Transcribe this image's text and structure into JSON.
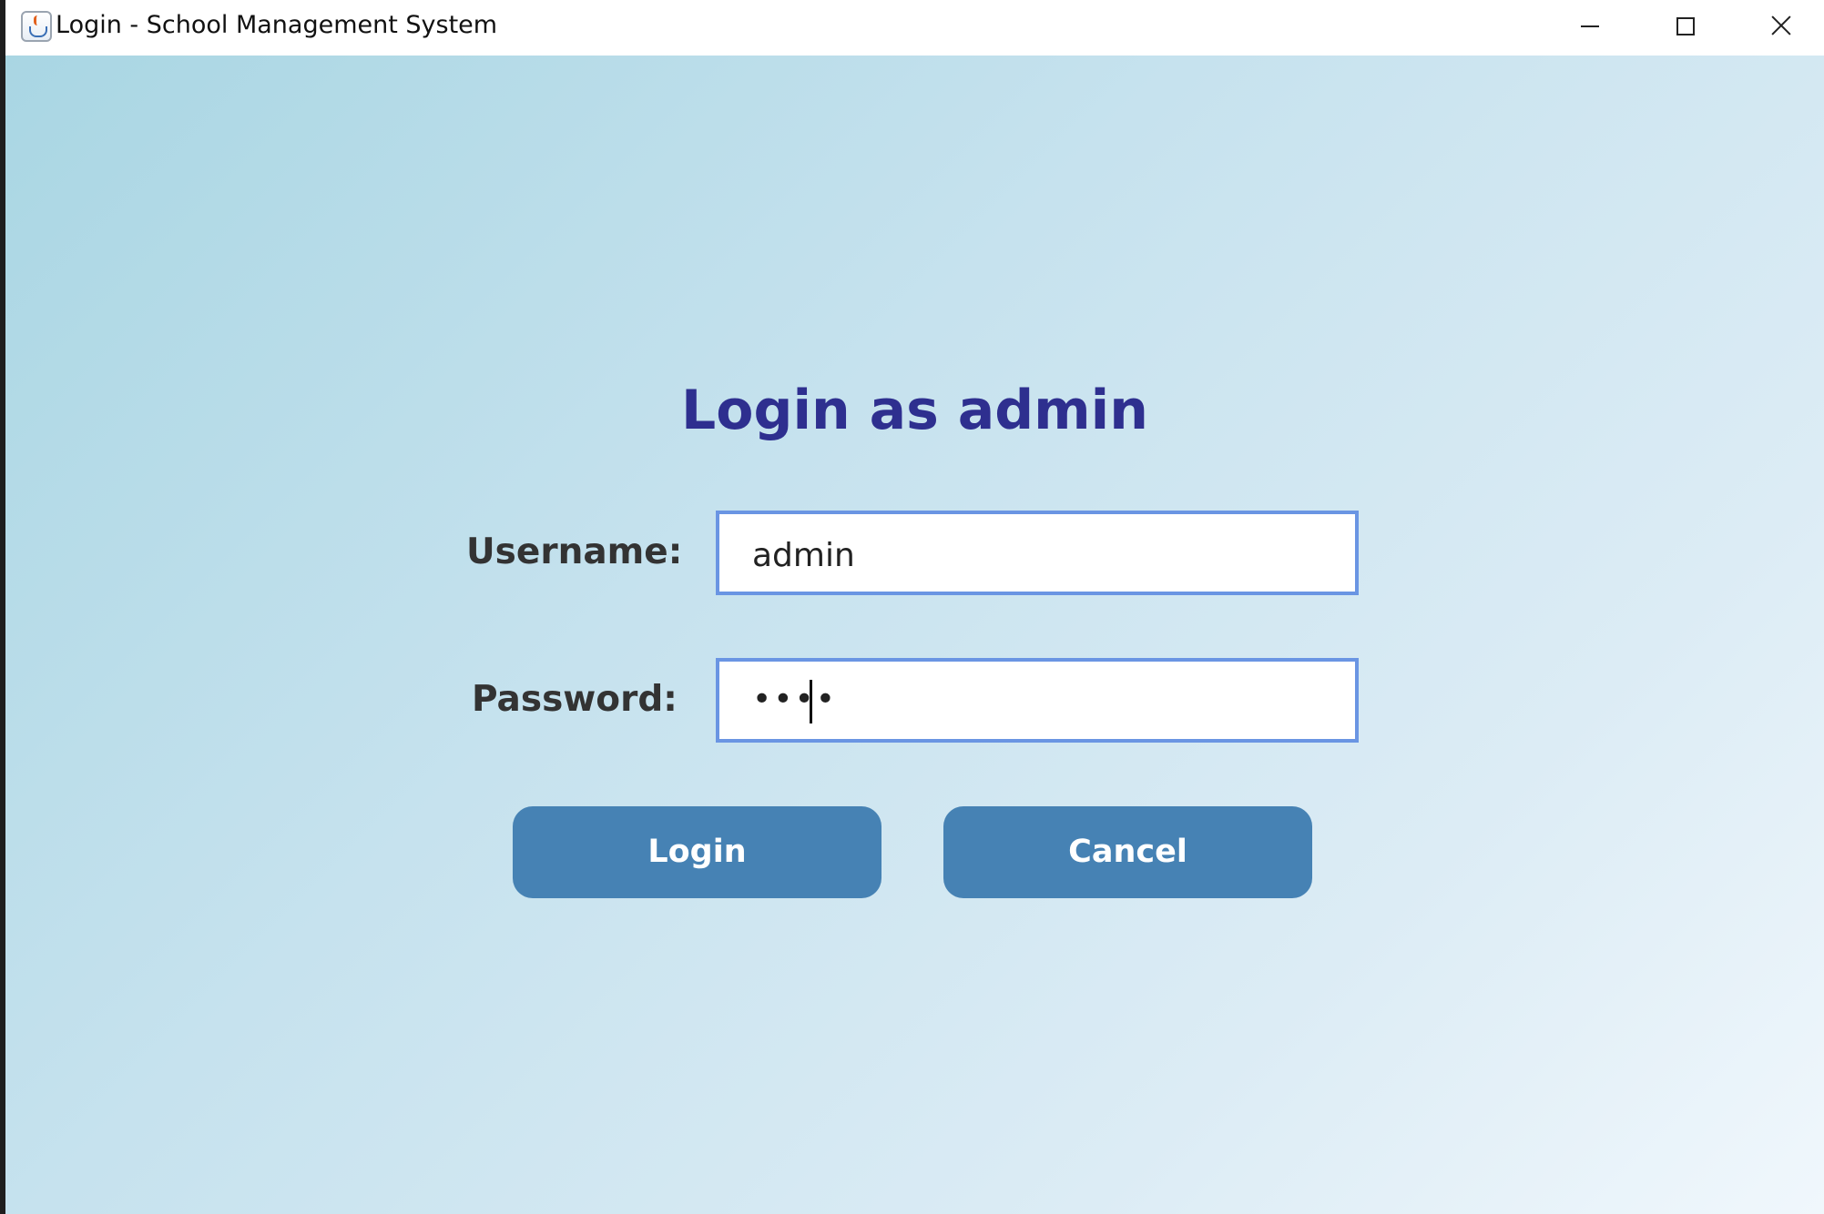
{
  "window": {
    "title": "Login - School Management System",
    "icon": "java-cup-icon",
    "controls": {
      "minimize": "minimize-icon",
      "maximize": "maximize-icon",
      "close": "close-icon"
    }
  },
  "form": {
    "heading": "Login as admin",
    "username_label": "Username:",
    "username_value": "admin",
    "password_label": "Password:",
    "password_value": "••••",
    "login_label": "Login",
    "cancel_label": "Cancel"
  },
  "colors": {
    "heading": "#2e2f8f",
    "button": "#4682b4",
    "field_border": "#6a95e3"
  }
}
